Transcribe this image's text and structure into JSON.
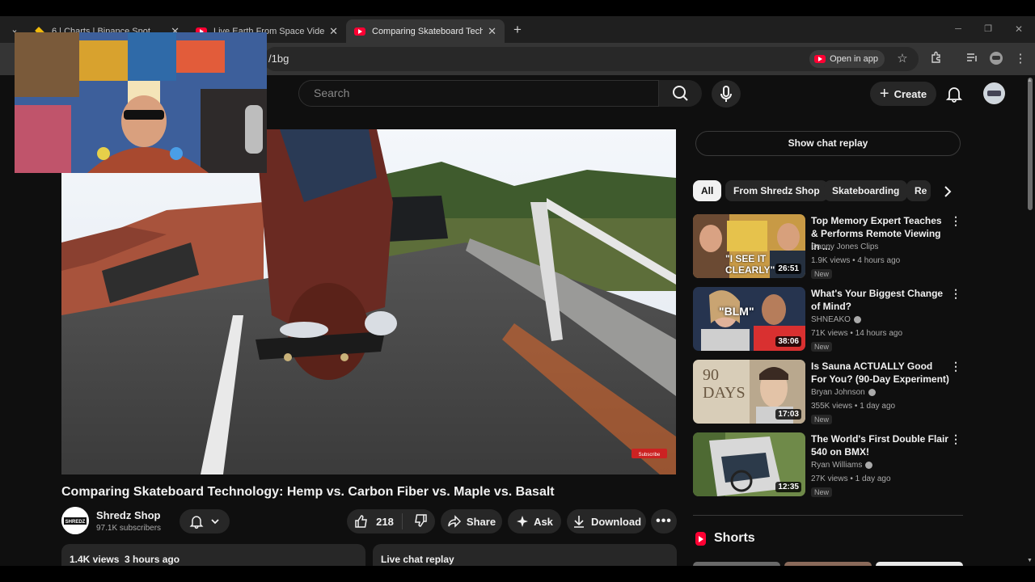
{
  "browser": {
    "tabs": [
      {
        "title": "6 | Charts | Binance Spot",
        "favicon": "binance-icon"
      },
      {
        "title": "Live Earth From Space Video fro",
        "favicon": "youtube-icon"
      },
      {
        "title": "Comparing Skateboard Technol",
        "favicon": "youtube-icon",
        "active": true
      }
    ],
    "new_tab": "+",
    "url_tail": "/1bg",
    "open_in_app": "Open in app",
    "window_controls": [
      "─",
      "❐",
      "✕"
    ]
  },
  "youtube": {
    "search_placeholder": "Search",
    "create_label": "Create"
  },
  "video": {
    "title": "Comparing Skateboard Technology: Hemp vs. Carbon Fiber vs. Maple vs. Basalt",
    "channel": "Shredz Shop",
    "channel_logo_text": "SHREDZ",
    "subscribers": "97.1K subscribers",
    "likes": "218",
    "share_label": "Share",
    "ask_label": "Ask",
    "download_label": "Download",
    "views_line": "1.4K views  3 hours ago",
    "live_chat_replay": "Live chat replay",
    "overlay_subscribe": "Subscribe"
  },
  "sidebar": {
    "show_chat_replay": "Show chat replay",
    "chips": [
      "All",
      "From Shredz Shop",
      "Skateboarding",
      "Re"
    ],
    "recommendations": [
      {
        "title": "Top Memory Expert Teaches & Performs Remote Viewing in ...",
        "channel": "Danny Jones Clips",
        "verified": false,
        "meta": "1.9K views • 4 hours ago",
        "badge": "New",
        "duration": "26:51",
        "thumb_text": "\"I SEE IT CLEARLY\""
      },
      {
        "title": "What's Your Biggest Change of Mind?",
        "channel": "SHNEAKO",
        "verified": true,
        "meta": "71K views • 14 hours ago",
        "badge": "New",
        "duration": "38:06",
        "thumb_text": "\"BLM\""
      },
      {
        "title": "Is Sauna ACTUALLY Good For You? (90-Day Experiment)",
        "channel": "Bryan Johnson",
        "verified": true,
        "meta": "355K views • 1 day ago",
        "badge": "New",
        "duration": "17:03",
        "thumb_text": "90 DAYS"
      },
      {
        "title": "The World's First Double Flair 540 on BMX!",
        "channel": "Ryan Williams",
        "verified": true,
        "meta": "27K views • 1 day ago",
        "badge": "New",
        "duration": "12:35",
        "thumb_text": ""
      }
    ],
    "shorts_label": "Shorts"
  },
  "colors": {
    "yt_red": "#ff0033",
    "background": "#0f0f0f",
    "chip_bg": "#272727"
  }
}
